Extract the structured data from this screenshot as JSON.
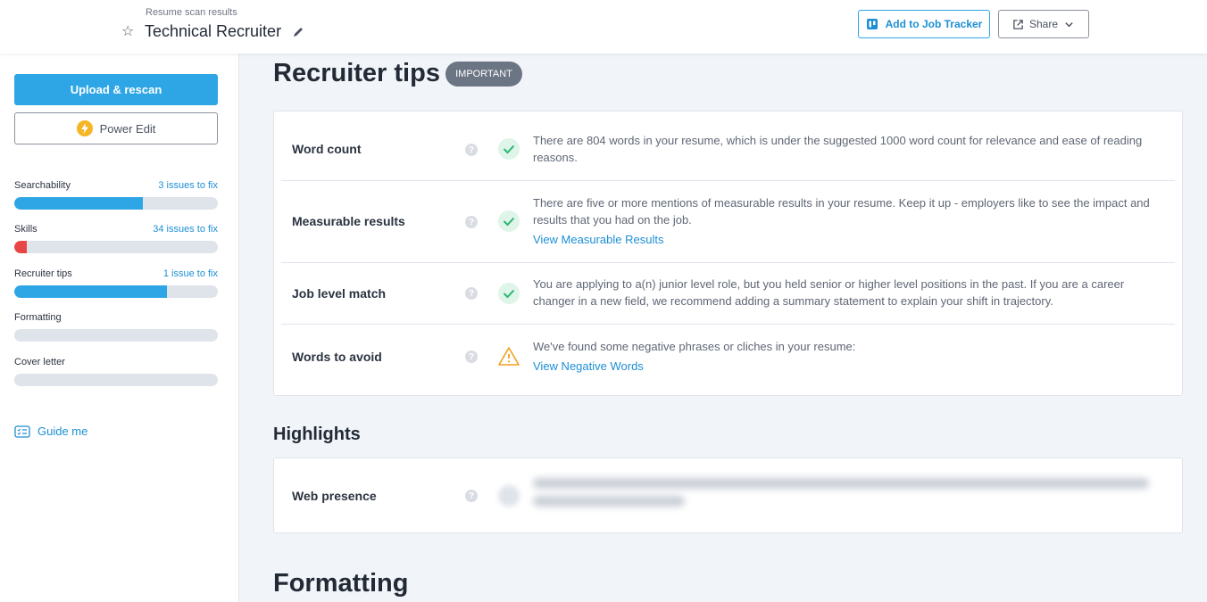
{
  "header": {
    "crumb": "Resume scan results",
    "title": "Technical Recruiter",
    "add_tracker_label": "Add to Job Tracker",
    "share_label": "Share"
  },
  "sidebar": {
    "upload_label": "Upload & rescan",
    "power_edit_label": "Power Edit",
    "metrics": [
      {
        "label": "Searchability",
        "issues": "3 issues to fix",
        "progress": 0.63,
        "color": "#2ea6e6"
      },
      {
        "label": "Skills",
        "issues": "34 issues to fix",
        "progress": 0.06,
        "color": "#e84545"
      },
      {
        "label": "Recruiter tips",
        "issues": "1 issue to fix",
        "progress": 0.75,
        "color": "#2ea6e6"
      },
      {
        "label": "Formatting",
        "issues": "",
        "progress": 0,
        "color": "#2ea6e6"
      },
      {
        "label": "Cover letter",
        "issues": "",
        "progress": 0,
        "color": "#2ea6e6"
      }
    ],
    "guide_label": "Guide me"
  },
  "main": {
    "recruiter_tips_title": "Recruiter tips",
    "important_badge": "IMPORTANT",
    "tips": [
      {
        "label": "Word count",
        "status": "check",
        "text": "There are 804 words in your resume, which is under the suggested 1000 word count for relevance and ease of reading reasons.",
        "link": ""
      },
      {
        "label": "Measurable results",
        "status": "check",
        "text": "There are five or more mentions of measurable results in your resume. Keep it up - employers like to see the impact and results that you had on the job.",
        "link": "View Measurable Results"
      },
      {
        "label": "Job level match",
        "status": "check",
        "text": "You are applying to a(n) junior level role, but you held senior or higher level positions in the past. If you are a career changer in a new field, we recommend adding a summary statement to explain your shift in trajectory.",
        "link": ""
      },
      {
        "label": "Words to avoid",
        "status": "warning",
        "text": "We've found some negative phrases or cliches in your resume:",
        "link": "View Negative Words"
      }
    ],
    "highlights_title": "Highlights",
    "web_presence_label": "Web presence",
    "formatting_title": "Formatting"
  }
}
